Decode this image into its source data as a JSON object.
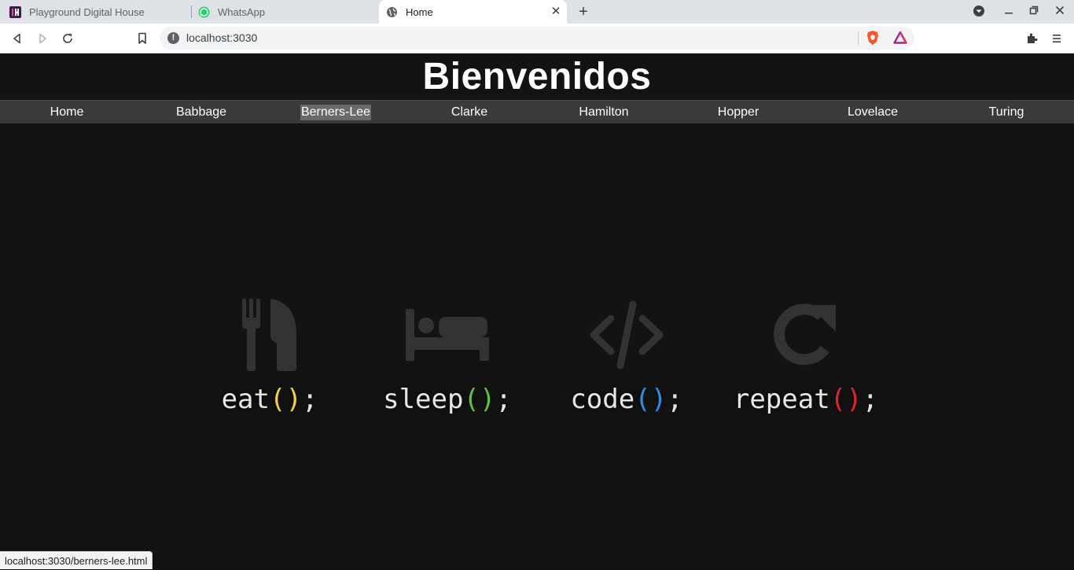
{
  "browser": {
    "tabs": [
      {
        "title": "Playground Digital House",
        "favicon": "digital-house-icon",
        "active": false
      },
      {
        "title": "WhatsApp",
        "favicon": "whatsapp-icon",
        "active": false
      },
      {
        "title": "Home",
        "favicon": "globe-icon",
        "active": true
      }
    ],
    "url": "localhost:3030",
    "status_url": "localhost:3030/berners-lee.html"
  },
  "page": {
    "title": "Bienvenidos",
    "nav": [
      "Home",
      "Babbage",
      "Berners-Lee",
      "Clarke",
      "Hamilton",
      "Hopper",
      "Lovelace",
      "Turing"
    ],
    "hovered_nav": "Berners-Lee",
    "hero": [
      {
        "word": "eat",
        "icon": "fork-knife-icon",
        "paren_color": "#f2d43b"
      },
      {
        "word": "sleep",
        "icon": "bed-icon",
        "paren_color": "#5cc43a"
      },
      {
        "word": "code",
        "icon": "code-icon",
        "paren_color": "#2d8ee6"
      },
      {
        "word": "repeat",
        "icon": "repeat-icon",
        "paren_color": "#e3242b"
      }
    ],
    "hero_parens": "()",
    "hero_semicolon": ";"
  }
}
